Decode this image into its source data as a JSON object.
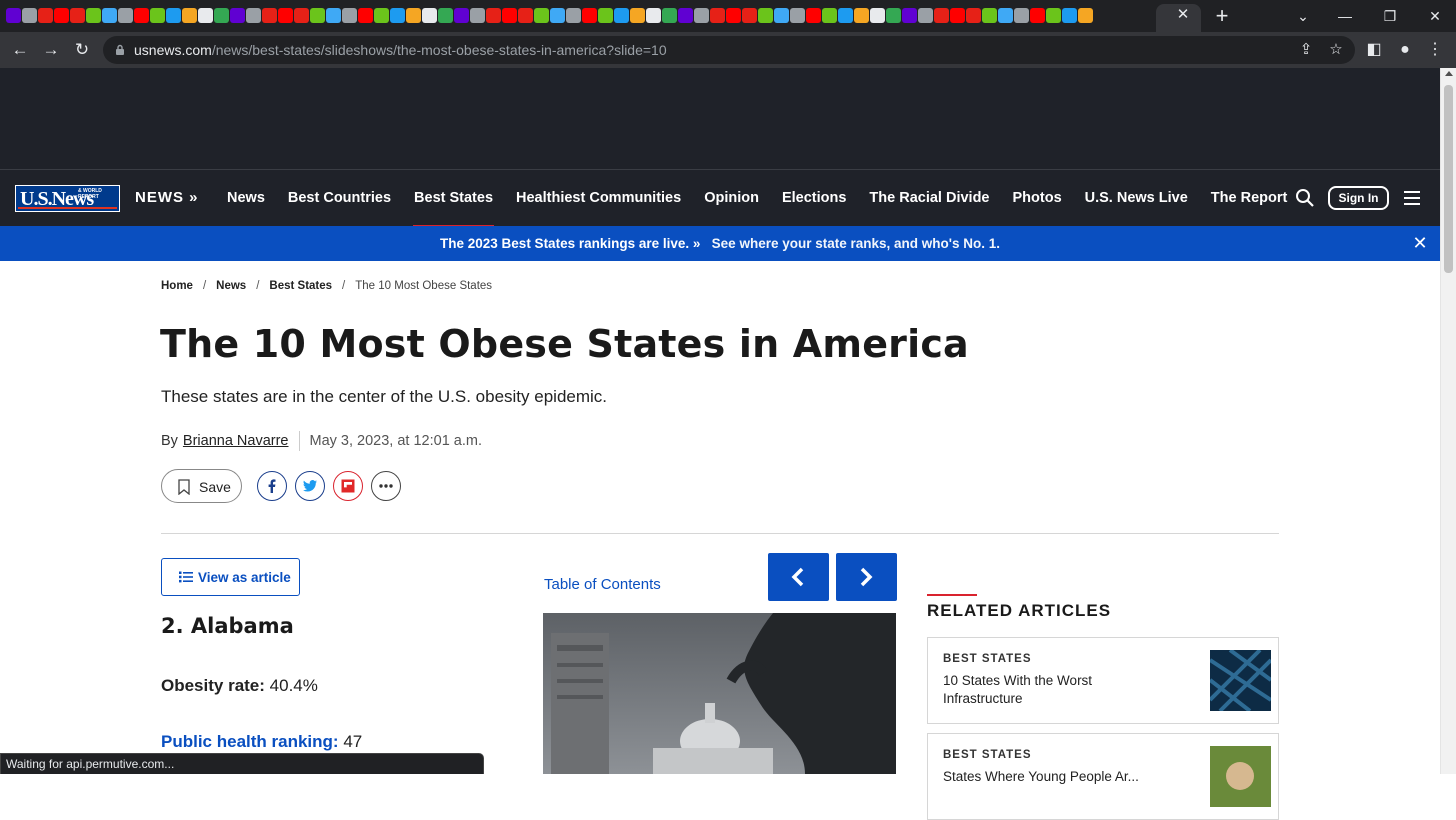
{
  "browser": {
    "tab_close": "✕",
    "new_tab": "+",
    "url_domain": "usnews.com",
    "url_path": "/news/best-states/slideshows/the-most-obese-states-in-america?slide=10",
    "status": "Waiting for api.permutive.com..."
  },
  "site": {
    "logo": "U.S.News",
    "logo_small": "& WORLD REPORT",
    "section_brand": "NEWS »",
    "nav": [
      "News",
      "Best Countries",
      "Best States",
      "Healthiest Communities",
      "Opinion",
      "Elections",
      "The Racial Divide",
      "Photos",
      "U.S. News Live",
      "The Report"
    ],
    "active_nav": "Best States",
    "sign_in": "Sign In"
  },
  "promo": {
    "lead": "The 2023 Best States rankings are live. »",
    "detail": "See where your state ranks, and who's No. 1.",
    "close": "✕"
  },
  "breadcrumb": [
    "Home",
    "News",
    "Best States"
  ],
  "breadcrumb_sep": "/",
  "breadcrumb_current": "The 10 Most Obese States",
  "article": {
    "title": "The 10 Most Obese States in America",
    "subtitle": "These states are in the center of the U.S. obesity epidemic.",
    "by": "By",
    "author": "Brianna Navarre",
    "date": "May 3, 2023, at 12:01 a.m.",
    "save": "Save"
  },
  "slide": {
    "view_as_article": "View as article",
    "heading": "2. Alabama",
    "obesity_label": "Obesity rate:",
    "obesity_value": "40.4%",
    "health_label": "Public health ranking:",
    "health_value": "47",
    "toc": "Table of Contents"
  },
  "related": {
    "heading": "RELATED ARTICLES",
    "items": [
      {
        "kicker": "BEST STATES",
        "title": "10 States With the Worst Infrastructure"
      },
      {
        "kicker": "BEST STATES",
        "title": "States Where Young People Ar..."
      }
    ]
  },
  "colors": {
    "brand_blue": "#0a4fc0",
    "nav_dark": "#1f2229",
    "accent_red": "#d9232e"
  }
}
